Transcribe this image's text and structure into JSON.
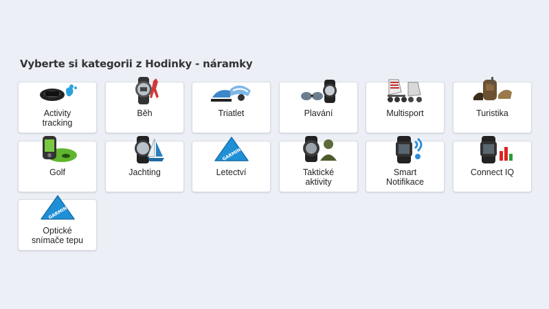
{
  "heading": "Vyberte si kategorii z Hodinky - náramky",
  "categories": [
    {
      "label": "Activity\ntracking",
      "icon": "activity-band-icon"
    },
    {
      "label": "Běh",
      "icon": "running-watch-icon"
    },
    {
      "label": "Triatlet",
      "icon": "triathlon-gear-icon"
    },
    {
      "label": "Plavání",
      "icon": "swimming-goggles-icon"
    },
    {
      "label": "Multisport",
      "icon": "skates-icon"
    },
    {
      "label": "Turistika",
      "icon": "hiking-backpack-icon"
    },
    {
      "label": "Golf",
      "icon": "golf-device-icon"
    },
    {
      "label": "Jachting",
      "icon": "sailing-watch-icon"
    },
    {
      "label": "Letectví",
      "icon": "garmin-triangle-icon"
    },
    {
      "label": "Taktické\naktivity",
      "icon": "tactical-watch-icon"
    },
    {
      "label": "Smart\nNotifikace",
      "icon": "smart-watch-icon"
    },
    {
      "label": "Connect IQ",
      "icon": "connect-iq-watch-icon"
    },
    {
      "label": "Optické\nsnímače tepu",
      "icon": "garmin-triangle-icon"
    }
  ],
  "colors": {
    "background": "#eceff6",
    "tile": "#ffffff",
    "garmin_blue": "#1f8fd6"
  }
}
